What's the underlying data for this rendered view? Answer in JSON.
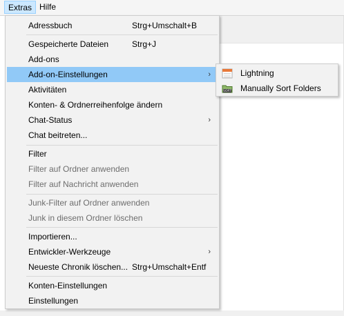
{
  "menubar": {
    "items": [
      {
        "label": "Extras"
      },
      {
        "label": "Hilfe"
      }
    ]
  },
  "extras_menu": {
    "items": [
      {
        "label": "Adressbuch",
        "accel": "Strg+Umschalt+B"
      },
      {
        "label": "Gespeicherte Dateien",
        "accel": "Strg+J"
      },
      {
        "label": "Add-ons",
        "accel": ""
      },
      {
        "label": "Add-on-Einstellungen",
        "accel": "",
        "submenu": true
      },
      {
        "label": "Aktivitäten",
        "accel": ""
      },
      {
        "label": "Konten- & Ordnerreihenfolge ändern",
        "accel": ""
      },
      {
        "label": "Chat-Status",
        "accel": "",
        "submenu": true
      },
      {
        "label": "Chat beitreten...",
        "accel": ""
      },
      {
        "label": "Filter",
        "accel": ""
      },
      {
        "label": "Filter auf Ordner anwenden",
        "accel": "",
        "disabled": true
      },
      {
        "label": "Filter auf Nachricht anwenden",
        "accel": "",
        "disabled": true
      },
      {
        "label": "Junk-Filter auf Ordner anwenden",
        "accel": "",
        "disabled": true
      },
      {
        "label": "Junk in diesem Ordner löschen",
        "accel": "",
        "disabled": true
      },
      {
        "label": "Importieren...",
        "accel": ""
      },
      {
        "label": "Entwickler-Werkzeuge",
        "accel": "",
        "submenu": true
      },
      {
        "label": "Neueste Chronik löschen...",
        "accel": "Strg+Umschalt+Entf"
      },
      {
        "label": "Konten-Einstellungen",
        "accel": ""
      },
      {
        "label": "Einstellungen",
        "accel": ""
      }
    ],
    "submenu_arrow": "›"
  },
  "addon_settings_submenu": {
    "items": [
      {
        "label": "Lightning",
        "icon": "calendar-icon"
      },
      {
        "label": "Manually Sort Folders",
        "icon": "sort-folders-icon",
        "icon_text": "SORT"
      }
    ]
  },
  "colors": {
    "highlight": "#91c9f7",
    "menubar_active": "#cce8ff",
    "menu_bg": "#f2f2f2",
    "disabled_text": "#6d6d6d"
  }
}
